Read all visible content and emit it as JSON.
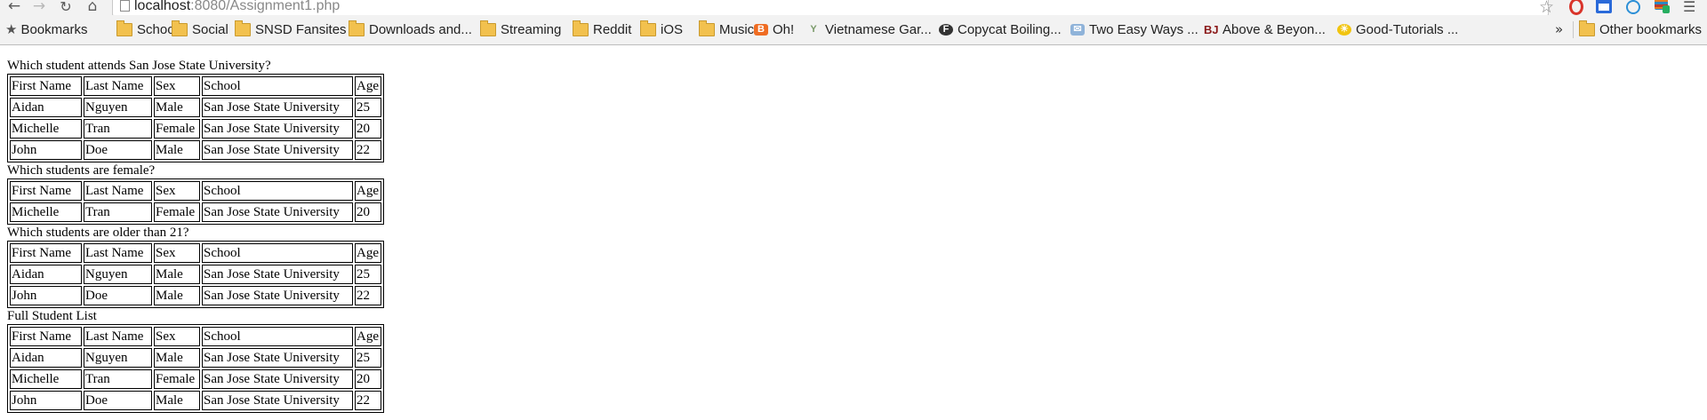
{
  "browser": {
    "url_host": "localhost",
    "url_path": ":8080/Assignment1.php",
    "bookmarks_label": "Bookmarks",
    "bookmarks": [
      {
        "label": "School",
        "icon": "folder-icon"
      },
      {
        "label": "Social",
        "icon": "folder-icon"
      },
      {
        "label": "SNSD Fansites",
        "icon": "folder-icon"
      },
      {
        "label": "Downloads and...",
        "icon": "folder-icon"
      },
      {
        "label": "Streaming",
        "icon": "folder-icon"
      },
      {
        "label": "Reddit",
        "icon": "folder-icon"
      },
      {
        "label": "iOS",
        "icon": "folder-icon"
      },
      {
        "label": "Music",
        "icon": "folder-icon"
      },
      {
        "label": "Oh!",
        "icon": "blogger-icon"
      },
      {
        "label": "Vietnamese Gar...",
        "icon": "leaf-icon"
      },
      {
        "label": "Copycat Boiling...",
        "icon": "f-icon"
      },
      {
        "label": "Two Easy Ways ...",
        "icon": "mail-icon"
      },
      {
        "label": "Above & Beyon...",
        "icon": "bj-icon"
      },
      {
        "label": "Good-Tutorials ...",
        "icon": "sun-icon"
      }
    ],
    "overflow_chevron": "»",
    "other_bookmarks": "Other bookmarks"
  },
  "page": {
    "headers": [
      "First Name",
      "Last Name",
      "Sex",
      "School",
      "Age"
    ],
    "sections": [
      {
        "question": "Which student attends San Jose State University?",
        "rows": [
          [
            "Aidan",
            "Nguyen",
            "Male",
            "San Jose State University",
            "25"
          ],
          [
            "Michelle",
            "Tran",
            "Female",
            "San Jose State University",
            "20"
          ],
          [
            "John",
            "Doe",
            "Male",
            "San Jose State University",
            "22"
          ]
        ]
      },
      {
        "question": "Which students are female?",
        "rows": [
          [
            "Michelle",
            "Tran",
            "Female",
            "San Jose State University",
            "20"
          ]
        ]
      },
      {
        "question": "Which students are older than 21?",
        "rows": [
          [
            "Aidan",
            "Nguyen",
            "Male",
            "San Jose State University",
            "25"
          ],
          [
            "John",
            "Doe",
            "Male",
            "San Jose State University",
            "22"
          ]
        ]
      },
      {
        "question": "Full Student List",
        "rows": [
          [
            "Aidan",
            "Nguyen",
            "Male",
            "San Jose State University",
            "25"
          ],
          [
            "Michelle",
            "Tran",
            "Female",
            "San Jose State University",
            "20"
          ],
          [
            "John",
            "Doe",
            "Male",
            "San Jose State University",
            "22"
          ]
        ]
      }
    ]
  }
}
